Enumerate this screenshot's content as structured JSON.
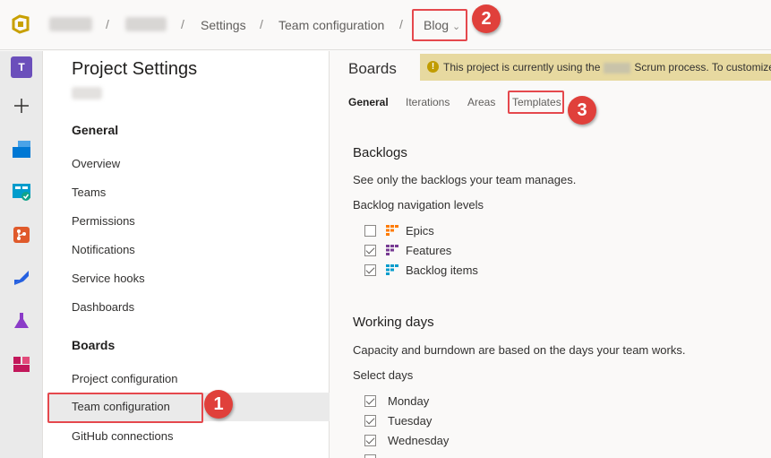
{
  "breadcrumb": {
    "settings": "Settings",
    "team_configuration": "Team configuration",
    "team": "Blog"
  },
  "sidebar": {
    "title": "Project Settings",
    "sections": [
      {
        "label": "General",
        "items": [
          "Overview",
          "Teams",
          "Permissions",
          "Notifications",
          "Service hooks",
          "Dashboards"
        ]
      },
      {
        "label": "Boards",
        "items": [
          "Project configuration",
          "Team configuration",
          "GitHub connections"
        ]
      }
    ],
    "selected": "Team configuration"
  },
  "main": {
    "title": "Boards",
    "banner_prefix": "This project is currently using the",
    "banner_suffix": "Scrum process. To customize",
    "tabs": [
      "General",
      "Iterations",
      "Areas",
      "Templates"
    ],
    "active_tab": "General",
    "backlogs": {
      "heading": "Backlogs",
      "description": "See only the backlogs your team manages.",
      "levels_label": "Backlog navigation levels",
      "levels": [
        {
          "label": "Epics",
          "checked": false,
          "color": "#ff7b00"
        },
        {
          "label": "Features",
          "checked": true,
          "color": "#773b93"
        },
        {
          "label": "Backlog items",
          "checked": true,
          "color": "#009ccc"
        }
      ]
    },
    "working_days": {
      "heading": "Working days",
      "description": "Capacity and burndown are based on the days your team works.",
      "select_label": "Select days",
      "days": [
        {
          "label": "Monday",
          "checked": true
        },
        {
          "label": "Tuesday",
          "checked": true
        },
        {
          "label": "Wednesday",
          "checked": true
        }
      ]
    }
  },
  "callouts": [
    "1",
    "2",
    "3"
  ],
  "colors": {
    "callout": "#e0403b",
    "accent_logo": "#c8a000"
  }
}
